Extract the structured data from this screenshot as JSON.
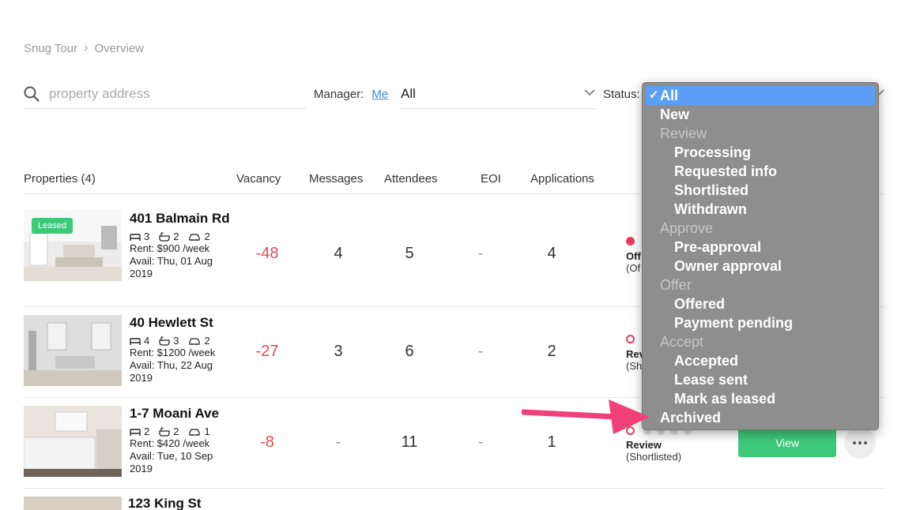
{
  "breadcrumb": {
    "root": "Snug Tour",
    "current": "Overview"
  },
  "filters": {
    "search_placeholder": "property address",
    "manager_label": "Manager:",
    "manager_me": "Me",
    "manager_value": "All",
    "status_label": "Status:"
  },
  "table": {
    "headers": {
      "properties": "Properties (4)",
      "vacancy": "Vacancy",
      "messages": "Messages",
      "attendees": "Attendees",
      "eoi": "EOI",
      "applications": "Applications"
    },
    "rows": [
      {
        "badge": "Leased",
        "address": "401 Balmain Rd",
        "beds": "3",
        "baths": "2",
        "cars": "2",
        "rent": "Rent: $900 /week",
        "avail": "Avail: Thu, 01 Aug 2019",
        "vacancy": "-48",
        "messages": "4",
        "attendees": "5",
        "eoi": "-",
        "applications": "4",
        "stage": "Off",
        "stage_sub": "(Of"
      },
      {
        "address": "40 Hewlett St",
        "beds": "4",
        "baths": "3",
        "cars": "2",
        "rent": "Rent: $1200 /week",
        "avail": "Avail: Thu, 22 Aug 2019",
        "vacancy": "-27",
        "messages": "3",
        "attendees": "6",
        "eoi": "-",
        "applications": "2",
        "stage": "Rev",
        "stage_sub": "(Sh"
      },
      {
        "address": "1-7 Moani Ave",
        "beds": "2",
        "baths": "2",
        "cars": "1",
        "rent": "Rent: $420 /week",
        "avail": "Avail: Tue, 10 Sep 2019",
        "vacancy": "-8",
        "messages": "-",
        "attendees": "11",
        "eoi": "-",
        "applications": "1",
        "stage": "Review",
        "stage_sub": "(Shortlisted)",
        "view_label": "View"
      },
      {
        "address": "123 King St"
      }
    ]
  },
  "status_dropdown": {
    "selected": "All",
    "options": [
      {
        "label": "All",
        "kind": "selected"
      },
      {
        "label": "New",
        "kind": "item"
      },
      {
        "label": "Review",
        "kind": "group"
      },
      {
        "label": "Processing",
        "kind": "child"
      },
      {
        "label": "Requested info",
        "kind": "child"
      },
      {
        "label": "Shortlisted",
        "kind": "child"
      },
      {
        "label": "Withdrawn",
        "kind": "child"
      },
      {
        "label": "Approve",
        "kind": "group"
      },
      {
        "label": "Pre-approval",
        "kind": "child"
      },
      {
        "label": "Owner approval",
        "kind": "child"
      },
      {
        "label": "Offer",
        "kind": "group"
      },
      {
        "label": "Offered",
        "kind": "child"
      },
      {
        "label": "Payment pending",
        "kind": "child"
      },
      {
        "label": "Accept",
        "kind": "group"
      },
      {
        "label": "Accepted",
        "kind": "child"
      },
      {
        "label": "Lease sent",
        "kind": "child"
      },
      {
        "label": "Mark as leased",
        "kind": "child"
      },
      {
        "label": "Archived",
        "kind": "item"
      }
    ]
  },
  "colors": {
    "accent_green": "#3ec97a",
    "vacancy_red": "#e8474f",
    "link_blue": "#3a8de0",
    "annotation_pink": "#f0407a",
    "dropdown_bg": "#8e8e8e",
    "dropdown_selected": "#5a9ff5"
  }
}
